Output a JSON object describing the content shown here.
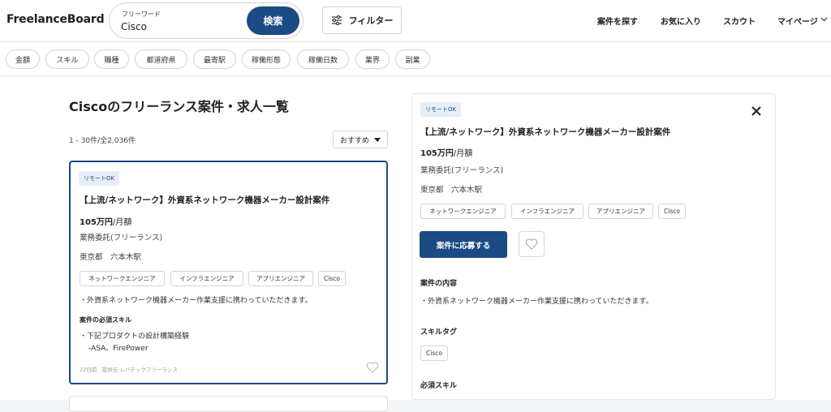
{
  "header": {
    "logo": "FreelanceBoard",
    "search_label": "フリーワード",
    "search_value": "Cisco",
    "search_button": "検索",
    "filter_label": "フィルター",
    "nav": [
      "案件を探す",
      "お気に入り",
      "スカウト",
      "マイページ"
    ]
  },
  "chips": [
    "金額",
    "スキル",
    "職種",
    "都道府県",
    "最寄駅",
    "稼働形態",
    "稼働日数",
    "業界",
    "副業"
  ],
  "listing": {
    "title": "Ciscoのフリーランス案件・求人一覧",
    "count": "1 - 30件/全2,036件",
    "sort": "おすすめ"
  },
  "card": {
    "badge": "リモートOK",
    "title": "【上流/ネットワーク】外資系ネットワーク機器メーカー設計案件",
    "price_value": "105万円",
    "price_unit": "/月額",
    "contract": "業務委託(フリーランス)",
    "location": "東京都　六本木駅",
    "tags": [
      "ネットワークエンジニア",
      "インフラエンジニア",
      "アプリエンジニア",
      "Cisco"
    ],
    "description": "・外資系ネットワーク機器メーカー作業支援に携わっていただきます。",
    "skills_heading": "案件の必須スキル",
    "skill_line1": "・下記プロダクトの設計構築経験",
    "skill_line2": "-ASA、FirePower",
    "meta": "22日前　提供元:レバテックフリーランス"
  },
  "detail": {
    "badge": "リモートOK",
    "title": "【上流/ネットワーク】外資系ネットワーク機器メーカー設計案件",
    "price_value": "105万円",
    "price_unit": "/月額",
    "contract": "業務委託(フリーランス)",
    "location": "東京都　六本木駅",
    "tags": [
      "ネットワークエンジニア",
      "インフラエンジニア",
      "アプリエンジニア",
      "Cisco"
    ],
    "apply_button": "案件に応募する",
    "content_heading": "案件の内容",
    "content_text": "・外資系ネットワーク機器メーカー作業支援に携わっていただきます。",
    "skilltag_heading": "スキルタグ",
    "skilltag": "Cisco",
    "required_heading": "必須スキル"
  },
  "colors": {
    "primary": "#1b4a84",
    "badge_bg": "#e6eef8"
  }
}
